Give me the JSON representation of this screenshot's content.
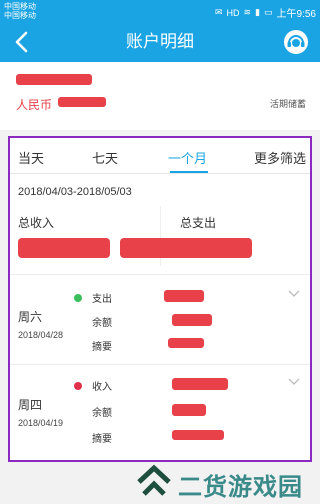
{
  "status_bar": {
    "carrier_1": "中国移动",
    "carrier_2": "中国移动",
    "time": "上午9:56",
    "icons": [
      "notification-icon",
      "hd-icon",
      "wifi-icon",
      "signal-icon",
      "battery-icon"
    ]
  },
  "header": {
    "title": "账户明细",
    "back_icon": "back-arrow-icon",
    "service_icon": "customer-service-icon"
  },
  "account": {
    "prefix": "人民币",
    "account_type": "活期储蓄"
  },
  "tabs": [
    {
      "label": "当天"
    },
    {
      "label": "七天"
    },
    {
      "label": "一个月",
      "active": true
    },
    {
      "label": "更多筛选"
    }
  ],
  "date_range": "2018/04/03-2018/05/03",
  "summary": {
    "income_label": "总收入",
    "expense_label": "总支出"
  },
  "transactions": [
    {
      "day": "周六",
      "date": "2018/04/28",
      "type": "支出",
      "type_color": "#3bbf5c",
      "labels": {
        "type": "支出",
        "balance": "余额",
        "memo": "摘要"
      }
    },
    {
      "day": "周四",
      "date": "2018/04/19",
      "type": "收入",
      "type_color": "#e0304a",
      "labels": {
        "type": "收入",
        "balance": "余额",
        "memo": "摘要"
      }
    }
  ],
  "watermark": {
    "text": "二货游戏园"
  },
  "colors": {
    "brand": "#1ba4e3",
    "redaction": "#e8414a",
    "highlight_border": "#8b2ac0"
  }
}
